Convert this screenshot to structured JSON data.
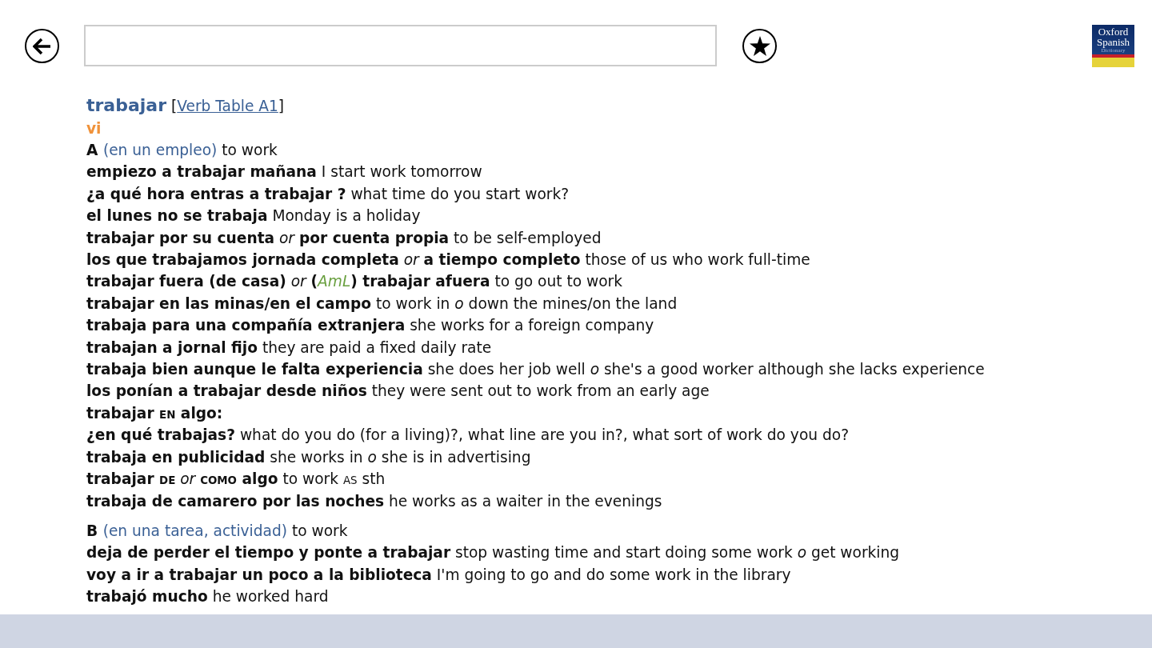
{
  "logo": {
    "lines": [
      "Oxford",
      "Spanish",
      "Dictionary"
    ]
  },
  "entry": {
    "headword": "trabajar",
    "bracket_open": "[",
    "link": "Verb Table A1",
    "bracket_close": "]",
    "pos": "vi",
    "sections": [
      {
        "lines": [
          [
            {
              "kind": "bold",
              "text": "A "
            },
            {
              "kind": "sense",
              "text": "(en un empleo)"
            },
            {
              "kind": "plain",
              "text": " to work"
            }
          ],
          [
            {
              "kind": "bold",
              "text": "empiezo a trabajar mañana"
            },
            {
              "kind": "plain",
              "text": " I start work tomorrow"
            }
          ],
          [
            {
              "kind": "bold",
              "text": "¿a qué hora entras a trabajar ?"
            },
            {
              "kind": "plain",
              "text": " what time do you start work?"
            }
          ],
          [
            {
              "kind": "bold",
              "text": "el lunes no se trabaja"
            },
            {
              "kind": "plain",
              "text": " Monday is a holiday"
            }
          ],
          [
            {
              "kind": "bold",
              "text": "trabajar por su cuenta"
            },
            {
              "kind": "italic",
              "text": " or "
            },
            {
              "kind": "bold",
              "text": "por cuenta propia"
            },
            {
              "kind": "plain",
              "text": " to be self-employed"
            }
          ],
          [
            {
              "kind": "bold",
              "text": "los que trabajamos jornada completa"
            },
            {
              "kind": "italic",
              "text": " or "
            },
            {
              "kind": "bold",
              "text": "a tiempo completo"
            },
            {
              "kind": "plain",
              "text": " those of us who work full-time"
            }
          ],
          [
            {
              "kind": "bold",
              "text": "trabajar fuera (de casa)"
            },
            {
              "kind": "italic",
              "text": " or "
            },
            {
              "kind": "bold",
              "text": "("
            },
            {
              "kind": "region",
              "text": "AmL"
            },
            {
              "kind": "bold",
              "text": ") trabajar afuera"
            },
            {
              "kind": "plain",
              "text": " to go out to work"
            }
          ],
          [
            {
              "kind": "bold",
              "text": "trabajar en las minas/en el campo"
            },
            {
              "kind": "plain",
              "text": " to work in "
            },
            {
              "kind": "italic",
              "text": "o"
            },
            {
              "kind": "plain",
              "text": " down the mines/on the land"
            }
          ],
          [
            {
              "kind": "bold",
              "text": "trabaja para una compañía extranjera"
            },
            {
              "kind": "plain",
              "text": " she works for a foreign company"
            }
          ],
          [
            {
              "kind": "bold",
              "text": "trabajan a jornal fijo"
            },
            {
              "kind": "plain",
              "text": " they are paid a fixed daily rate"
            }
          ],
          [
            {
              "kind": "bold",
              "text": "trabaja bien aunque le falta experiencia"
            },
            {
              "kind": "plain",
              "text": " she does her job well "
            },
            {
              "kind": "italic",
              "text": "o"
            },
            {
              "kind": "plain",
              "text": " she's a good worker although she lacks experience"
            }
          ],
          [
            {
              "kind": "bold",
              "text": "los ponían a trabajar desde niños"
            },
            {
              "kind": "plain",
              "text": " they were sent out to work from an early age"
            }
          ],
          [
            {
              "kind": "bold",
              "text": "trabajar "
            },
            {
              "kind": "smallcaps_bold",
              "text": "EN"
            },
            {
              "kind": "bold",
              "text": " algo:"
            }
          ],
          [
            {
              "kind": "bold",
              "text": "¿en qué trabajas?"
            },
            {
              "kind": "plain",
              "text": " what do you do (for a living)?, what line are you in?, what sort of work do you do?"
            }
          ],
          [
            {
              "kind": "bold",
              "text": "trabaja en publicidad"
            },
            {
              "kind": "plain",
              "text": " she works in "
            },
            {
              "kind": "italic",
              "text": "o"
            },
            {
              "kind": "plain",
              "text": " she is in advertising"
            }
          ],
          [
            {
              "kind": "bold",
              "text": "trabajar "
            },
            {
              "kind": "smallcaps_bold",
              "text": "DE"
            },
            {
              "kind": "italic",
              "text": " or "
            },
            {
              "kind": "smallcaps_bold",
              "text": "COMO"
            },
            {
              "kind": "bold",
              "text": " algo"
            },
            {
              "kind": "plain",
              "text": " to work "
            },
            {
              "kind": "smallcaps",
              "text": "AS"
            },
            {
              "kind": "plain",
              "text": " sth"
            }
          ],
          [
            {
              "kind": "bold",
              "text": "trabaja de camarero por las noches"
            },
            {
              "kind": "plain",
              "text": " he works as a waiter in the evenings"
            }
          ]
        ]
      },
      {
        "lines": [
          [
            {
              "kind": "bold",
              "text": "B "
            },
            {
              "kind": "sense",
              "text": "(en una tarea, actividad)"
            },
            {
              "kind": "plain",
              "text": " to work"
            }
          ],
          [
            {
              "kind": "bold",
              "text": "deja de perder el tiempo y ponte a trabajar"
            },
            {
              "kind": "plain",
              "text": " stop wasting time and start doing some work "
            },
            {
              "kind": "italic",
              "text": "o"
            },
            {
              "kind": "plain",
              "text": " get working"
            }
          ],
          [
            {
              "kind": "bold",
              "text": "voy a ir a trabajar un poco a la biblioteca"
            },
            {
              "kind": "plain",
              "text": " I'm going to go and do some work in the library"
            }
          ],
          [
            {
              "kind": "bold",
              "text": "trabajó mucho"
            },
            {
              "kind": "plain",
              "text": " he worked hard"
            }
          ]
        ]
      }
    ]
  }
}
